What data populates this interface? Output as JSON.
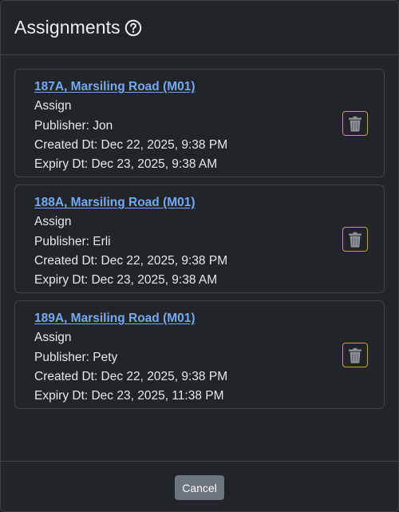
{
  "modal": {
    "title": "Assignments",
    "help_icon": "question-circle-icon"
  },
  "colors": {
    "background": "#212529",
    "link": "#74a9f6",
    "trash_border": "#c9a227",
    "cancel_bg": "#6c757d"
  },
  "assignments": [
    {
      "location": "187A, Marsiling Road (M01)",
      "type": "Assign",
      "publisher": "Publisher: Jon",
      "created": "Created Dt: Dec 22, 2025, 9:38 PM",
      "expiry": "Expiry Dt: Dec 23, 2025, 9:38 AM",
      "delete_icon": "trash-icon"
    },
    {
      "location": "188A, Marsiling Road (M01)",
      "type": "Assign",
      "publisher": "Publisher: Erli",
      "created": "Created Dt: Dec 22, 2025, 9:38 PM",
      "expiry": "Expiry Dt: Dec 23, 2025, 9:38 AM",
      "delete_icon": "trash-icon"
    },
    {
      "location": "189A, Marsiling Road (M01)",
      "type": "Assign",
      "publisher": "Publisher: Pety",
      "created": "Created Dt: Dec 22, 2025, 9:38 PM",
      "expiry": "Expiry Dt: Dec 23, 2025, 11:38 PM",
      "delete_icon": "trash-icon"
    }
  ],
  "footer": {
    "cancel_label": "Cancel"
  }
}
